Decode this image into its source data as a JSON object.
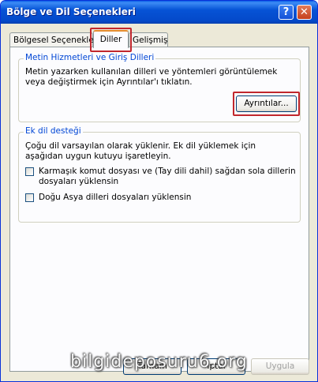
{
  "window": {
    "title": "Bölge ve Dil Seçenekleri",
    "help_glyph": "?",
    "close_glyph": "✕"
  },
  "tabs": [
    {
      "label": "Bölgesel Seçenekler",
      "active": false
    },
    {
      "label": "Diller",
      "active": true
    },
    {
      "label": "Gelişmiş",
      "active": false
    }
  ],
  "group_text_services": {
    "legend": "Metin Hizmetleri ve Giriş Dilleri",
    "description": "Metin yazarken kullanılan dilleri ve yöntemleri görüntülemek veya değiştirmek için Ayrıntılar'ı tıklatın.",
    "details_button": "Ayrıntılar..."
  },
  "group_extra_lang": {
    "legend": "Ek dil desteği",
    "description": "Çoğu dil varsayılan olarak yüklenir. Ek dil yüklemek için aşağıdan uygun kutuyu işaretleyin.",
    "checkbox_complex": {
      "line1": "Karmaşık komut dosyası ve (Tay dili dahil) sağdan sola dillerin",
      "line2": "dosyaları yüklensin",
      "checked": false
    },
    "checkbox_east_asian": {
      "label": "Doğu Asya dilleri dosyaları yüklensin",
      "checked": false
    }
  },
  "footer": {
    "ok_button": "Tamam",
    "cancel_button": "İptal",
    "apply_button": "Uygula"
  },
  "watermark": "bilgideposuru6.org",
  "colors": {
    "titlebar": "#0653d6",
    "highlight_box": "#c1272d",
    "legend_text": "#0046d5",
    "dialog_bg": "#ece9d8"
  }
}
